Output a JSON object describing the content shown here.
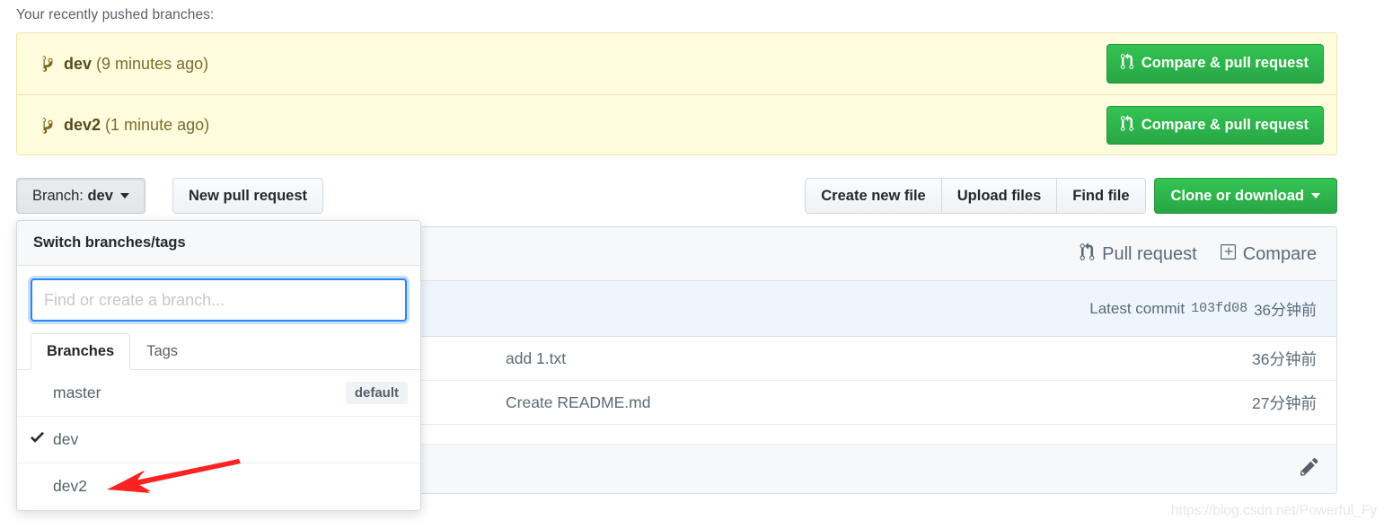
{
  "page": {
    "recently_pushed_label": "Your recently pushed branches:",
    "watermark": "https://blog.csdn.net/Powerful_Fy"
  },
  "colors": {
    "banner_bg": "#fffbdd",
    "banner_border": "#f5e4a6",
    "banner_text": "#6b5e24",
    "green_button": "#28a745",
    "focus_blue": "#2188ff",
    "commit_bar_bg": "#eef5fd",
    "annotation_red": "#fb2222"
  },
  "pushed_branches": [
    {
      "icon": "git-branch-icon",
      "name": "dev",
      "time": "(9 minutes ago)",
      "button_label": "Compare & pull request",
      "button_icon": "git-pull-request-icon"
    },
    {
      "icon": "git-branch-icon",
      "name": "dev2",
      "time": "(1 minute ago)",
      "button_label": "Compare & pull request",
      "button_icon": "git-pull-request-icon"
    }
  ],
  "toolbar": {
    "branch_prefix": "Branch:",
    "branch_current": "dev",
    "new_pull_request_label": "New pull request",
    "create_new_file_label": "Create new file",
    "upload_files_label": "Upload files",
    "find_file_label": "Find file",
    "clone_or_download_label": "Clone or download"
  },
  "dropdown": {
    "title": "Switch branches/tags",
    "search_placeholder": "Find or create a branch...",
    "search_value": "",
    "tabs": [
      {
        "label": "Branches",
        "selected": true
      },
      {
        "label": "Tags",
        "selected": false
      }
    ],
    "items": [
      {
        "label": "master",
        "checked": false,
        "badge": "default"
      },
      {
        "label": "dev",
        "checked": true,
        "badge": ""
      },
      {
        "label": "dev2",
        "checked": false,
        "badge": ""
      }
    ]
  },
  "panel": {
    "header_links": [
      {
        "label": "Pull request",
        "icon": "git-pull-request-icon"
      },
      {
        "label": "Compare",
        "icon": "file-diff-icon"
      }
    ],
    "commit_bar": {
      "prefix": "Latest commit",
      "sha": "103fd08",
      "time": "36分钟前"
    },
    "files": [
      {
        "message": "add 1.txt",
        "time": "36分钟前"
      },
      {
        "message": "Create README.md",
        "time": "27分钟前"
      }
    ],
    "readme_bar": {
      "edit_icon": "pencil-icon"
    }
  }
}
